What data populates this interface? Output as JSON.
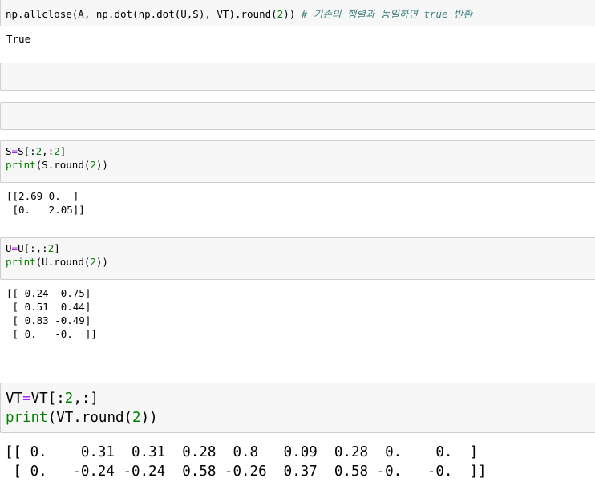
{
  "cells": [
    {
      "input": {
        "prefix": "np.allclose(A, np.dot(np.dot(U,S), VT).round(",
        "arg": "2",
        "suffix": ")) ",
        "comment": "# 기존의 행렬과 동일하면 true 반환"
      },
      "output": "True"
    },
    {
      "input": ""
    },
    {
      "input": ""
    },
    {
      "input": {
        "line1_lhs": "S",
        "line1_eq": "=",
        "line1_rhs_a": "S[:",
        "line1_n1": "2",
        "line1_mid": ",:",
        "line1_n2": "2",
        "line1_end": "]",
        "line2_fn": "print",
        "line2_open": "(S.round(",
        "line2_n": "2",
        "line2_close": "))"
      },
      "output": "[[2.69 0.  ]\n [0.   2.05]]"
    },
    {
      "input": {
        "line1_lhs": "U",
        "line1_eq": "=",
        "line1_rhs_a": "U[:,:",
        "line1_n": "2",
        "line1_end": "]",
        "line2_fn": "print",
        "line2_open": "(U.round(",
        "line2_n": "2",
        "line2_close": "))"
      },
      "output": "[[ 0.24  0.75]\n [ 0.51  0.44]\n [ 0.83 -0.49]\n [ 0.   -0.  ]]"
    },
    {
      "input": {
        "line1_lhs": "VT",
        "line1_eq": "=",
        "line1_rhs_a": "VT[:",
        "line1_n": "2",
        "line1_end": ",:]",
        "line2_fn": "print",
        "line2_open": "(VT.round(",
        "line2_n": "2",
        "line2_close": "))"
      },
      "output": "[[ 0.    0.31  0.31  0.28  0.8   0.09  0.28  0.    0.  ]\n [ 0.   -0.24 -0.24  0.58 -0.26  0.37  0.58 -0.   -0.  ]]"
    }
  ]
}
